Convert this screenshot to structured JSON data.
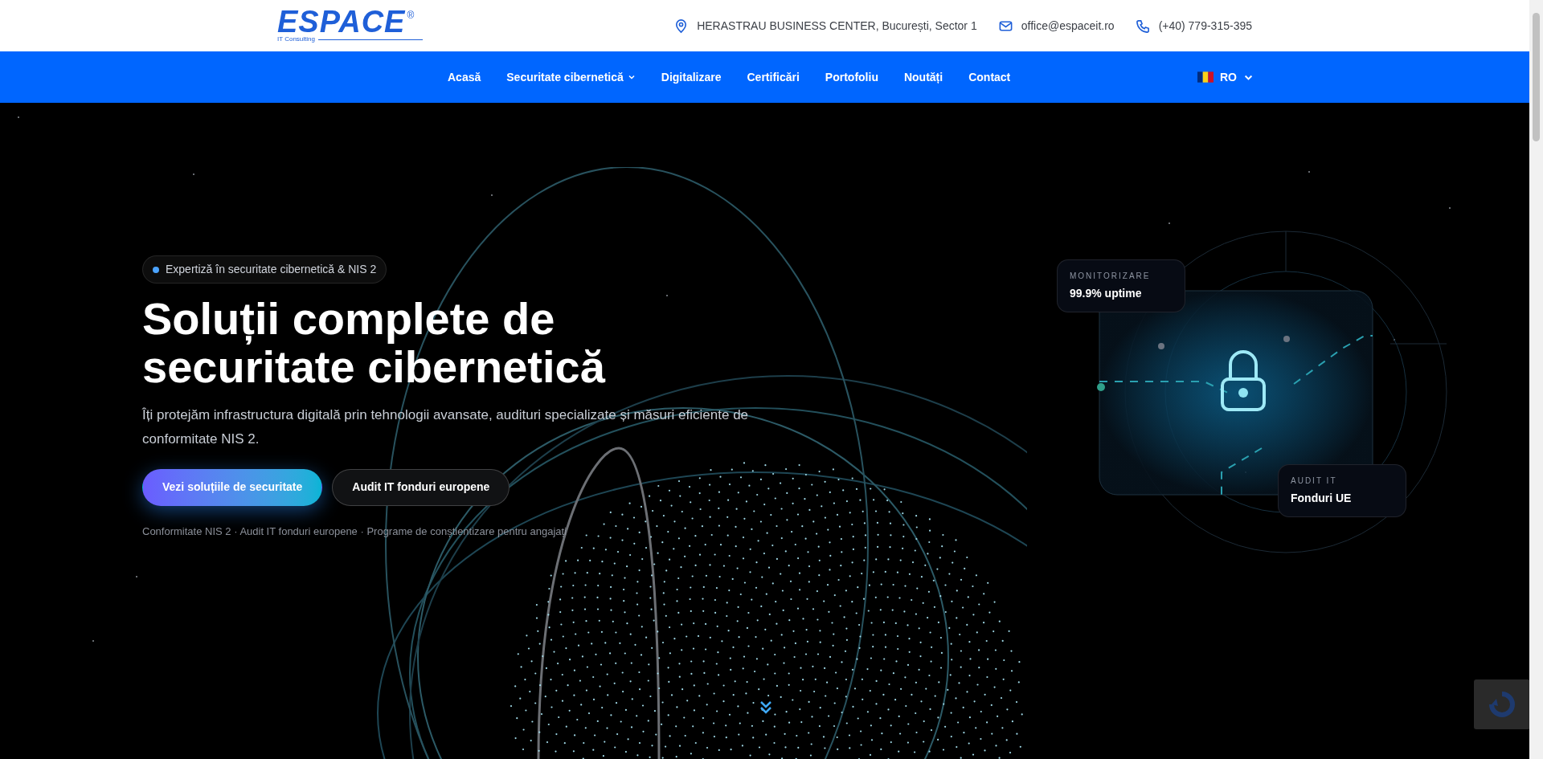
{
  "header": {
    "logo": {
      "wordmark": "ESPACE",
      "registered": "®",
      "tagline": "IT Consulting"
    },
    "contacts": [
      {
        "kind": "address",
        "text": "HERASTRAU BUSINESS CENTER, București, Sector 1"
      },
      {
        "kind": "email",
        "text": "office@espaceit.ro"
      },
      {
        "kind": "phone",
        "text": "(+40) 779-315-395"
      }
    ]
  },
  "nav": {
    "items": [
      {
        "label": "Acasă",
        "dropdown": false
      },
      {
        "label": "Securitate cibernetică",
        "dropdown": true
      },
      {
        "label": "Digitalizare",
        "dropdown": false
      },
      {
        "label": "Certificări",
        "dropdown": false
      },
      {
        "label": "Portofoliu",
        "dropdown": false
      },
      {
        "label": "Noutăți",
        "dropdown": false
      },
      {
        "label": "Contact",
        "dropdown": false
      }
    ],
    "language": {
      "code": "RO"
    }
  },
  "hero": {
    "badge": "Expertiză în securitate cibernetică & NIS 2",
    "title": "Soluții complete de securitate cibernetică",
    "subtitle": "Îți protejăm infrastructura digitală prin tehnologii avansate, audituri specializate și măsuri eficiente de conformitate NIS 2.",
    "buttons": [
      {
        "label": "Vezi soluțiile de securitate",
        "kind": "primary"
      },
      {
        "label": "Audit IT fonduri europene",
        "kind": "secondary"
      }
    ],
    "footnote": "Conformitate NIS 2 · Audit IT fonduri europene · Programe de conștientizare pentru angajați"
  },
  "cards": [
    {
      "label": "MONITORIZARE",
      "value": "99.9% uptime"
    },
    {
      "label": "AUDIT IT",
      "value": "Fonduri UE"
    }
  ]
}
